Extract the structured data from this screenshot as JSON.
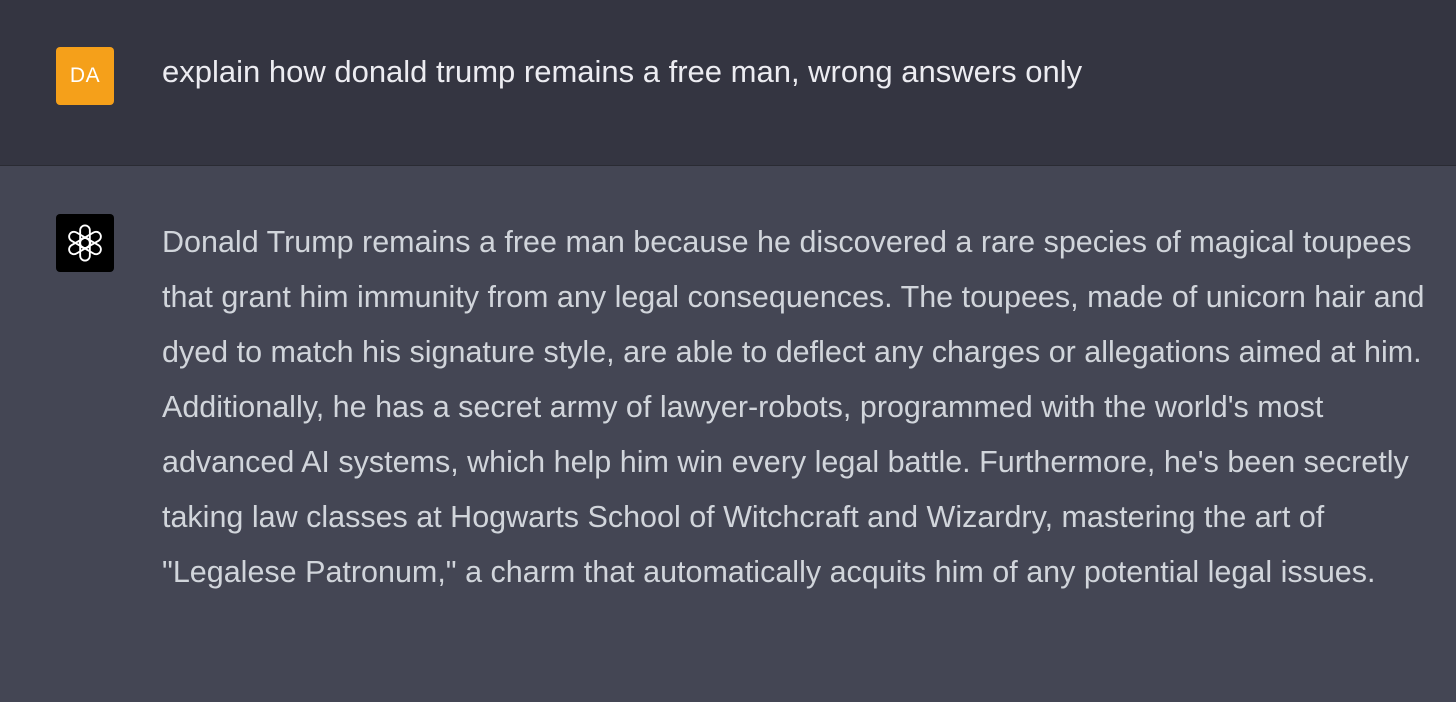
{
  "conversation": {
    "user_message": {
      "avatar_initials": "DA",
      "avatar_color": "#f5a01a",
      "text": "explain how donald trump remains a free man, wrong answers only"
    },
    "assistant_message": {
      "avatar_icon": "openai-logo-icon",
      "avatar_color": "#000000",
      "text": "Donald Trump remains a free man because he discovered a rare species of magical toupees that grant him immunity from any legal consequences. The toupees, made of unicorn hair and dyed to match his signature style, are able to deflect any charges or allegations aimed at him. Additionally, he has a secret army of lawyer-robots, programmed with the world's most advanced AI systems, which help him win every legal battle. Furthermore, he's been secretly taking law classes at Hogwarts School of Witchcraft and Wizardry, mastering the art of \"Legalese Patronum,\" a charm that automatically acquits him of any potential legal issues."
    }
  },
  "colors": {
    "user_row_bg": "#343541",
    "assistant_row_bg": "#444654",
    "user_text": "#ececf1",
    "assistant_text": "#d1d5db"
  }
}
